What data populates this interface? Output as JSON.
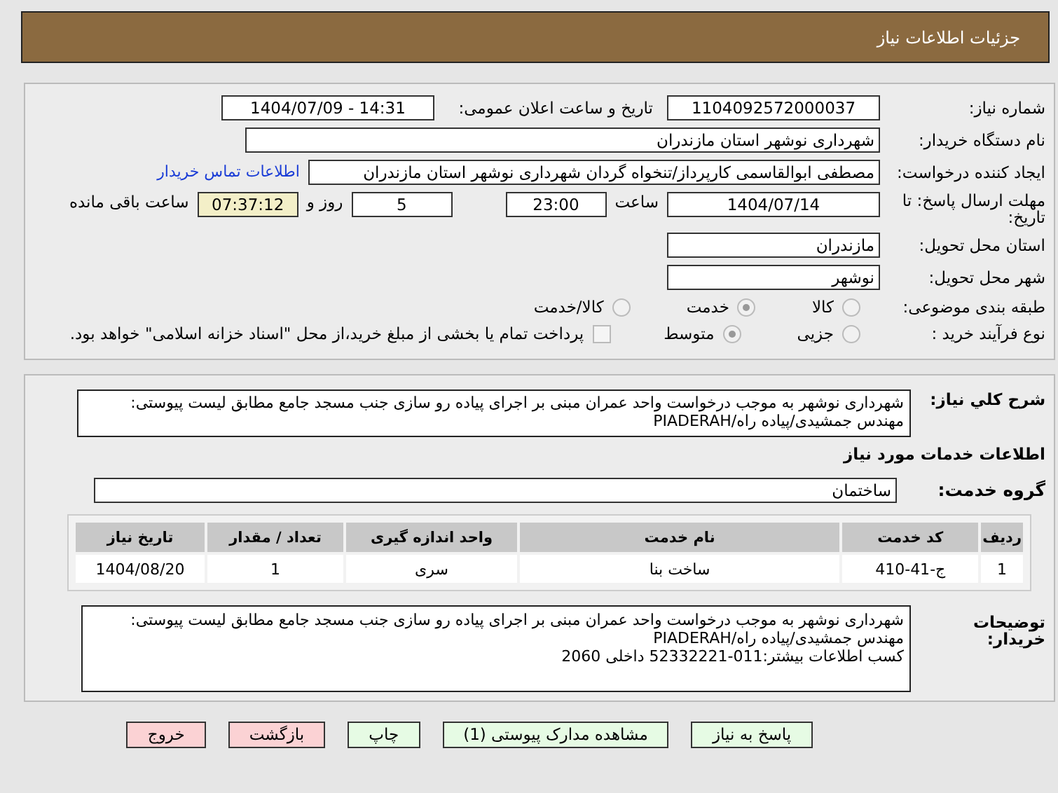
{
  "header": {
    "title": "جزئیات اطلاعات نیاز"
  },
  "need_number": {
    "label": "شماره نیاز:",
    "value": "1104092572000037"
  },
  "announce": {
    "label": "تاریخ و ساعت اعلان عمومی:",
    "value": "1404/07/09 - 14:31"
  },
  "buyer": {
    "label": "نام دستگاه خریدار:",
    "value": "شهرداری نوشهر استان مازندران"
  },
  "creator": {
    "label": "ایجاد کننده درخواست:",
    "value": "مصطفی  ابوالقاسمی کارپرداز/تنخواه گردان شهرداری نوشهر استان مازندران",
    "link": "اطلاعات تماس خریدار"
  },
  "deadline": {
    "label": "مهلت ارسال پاسخ: تا تاریخ:",
    "date": "1404/07/14",
    "time_label": "ساعت",
    "time": "23:00",
    "days": "5",
    "days_label": "روز و",
    "remaining": "07:37:12",
    "remaining_label": "ساعت باقی مانده"
  },
  "province": {
    "label": "استان محل تحویل:",
    "value": "مازندران"
  },
  "city": {
    "label": "شهر محل تحویل:",
    "value": "نوشهر"
  },
  "category": {
    "label": "طبقه بندی موضوعی:",
    "options": [
      {
        "label": "کالا",
        "selected": false
      },
      {
        "label": "خدمت",
        "selected": true
      },
      {
        "label": "کالا/خدمت",
        "selected": false
      }
    ]
  },
  "purchase": {
    "label": "نوع فرآیند خرید :",
    "options": [
      {
        "label": "جزیی",
        "selected": false
      },
      {
        "label": "متوسط",
        "selected": true
      }
    ],
    "payment_checked": false,
    "payment_text": "پرداخت تمام یا بخشی از مبلغ خرید،از محل \"اسناد خزانه اسلامی\" خواهد بود."
  },
  "description": {
    "label": "شرح کلي نياز:",
    "value": "شهرداری نوشهر به موجب درخواست واحد عمران مبنی بر اجرای پیاده رو سازی جنب مسجد جامع مطابق لیست پیوستی: مهندس جمشیدی/پیاده راه/PIADERAH"
  },
  "services_title": "اطلاعات خدمات مورد نياز",
  "service_group": {
    "label": "گروه خدمت:",
    "value": "ساختمان"
  },
  "table": {
    "columns": [
      "ردیف",
      "کد خدمت",
      "نام خدمت",
      "واحد اندازه گیری",
      "تعداد / مقدار",
      "تاریخ نیاز"
    ],
    "rows": [
      [
        "1",
        "ج-41-410",
        "ساخت بنا",
        "سری",
        "1",
        "1404/08/20"
      ]
    ]
  },
  "buyer_notes": {
    "label": "توضیحات خریدار:",
    "lines": [
      "شهرداری نوشهر به موجب درخواست واحد عمران مبنی بر اجرای پیاده رو سازی جنب مسجد جامع مطابق لیست پیوستی:",
      "مهندس جمشیدی/پیاده راه/PIADERAH",
      "کسب اطلاعات بیشتر:011-52332221 داخلی 2060"
    ]
  },
  "buttons": [
    {
      "label": "پاسخ به نیاز",
      "kind": "action"
    },
    {
      "label": "مشاهده مدارک پیوستی (1)",
      "kind": "action"
    },
    {
      "label": "چاپ",
      "kind": "action"
    },
    {
      "label": "بازگشت",
      "kind": "exit"
    },
    {
      "label": "خروج",
      "kind": "exit"
    }
  ]
}
